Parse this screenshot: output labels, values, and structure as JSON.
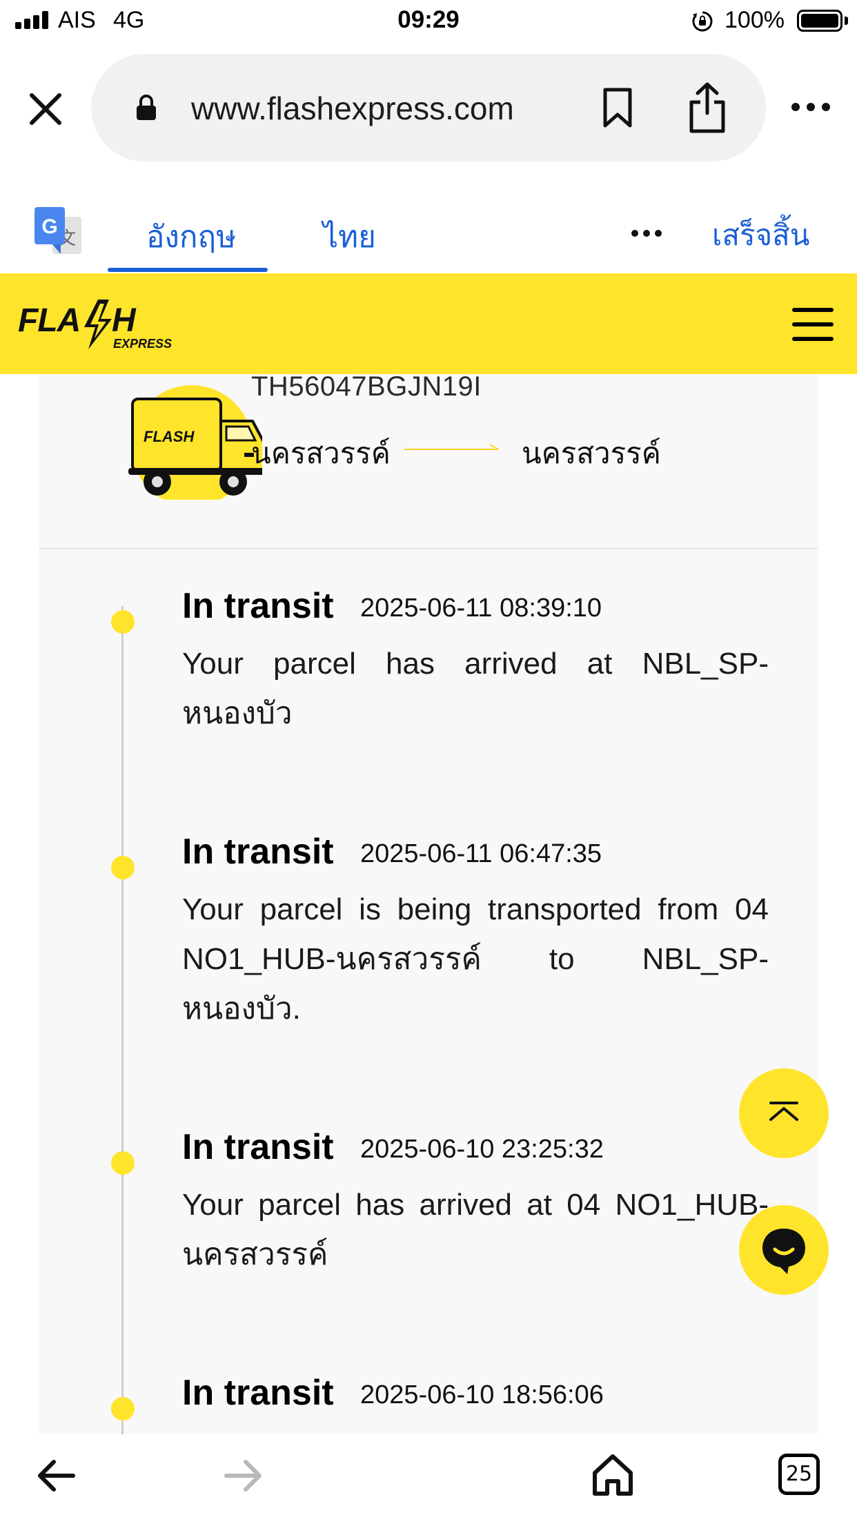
{
  "status_bar": {
    "carrier": "AIS",
    "network": "4G",
    "time": "09:29",
    "battery_percent": "100%",
    "icons": [
      "signal-icon",
      "rotation-lock-icon",
      "battery-icon"
    ]
  },
  "browser": {
    "url": "www.flashexpress.com",
    "tab_count": "25",
    "icons": [
      "close-icon",
      "padlock-icon",
      "bookmark-icon",
      "share-icon",
      "more-icon",
      "back-icon",
      "forward-icon",
      "home-icon",
      "tabs-icon"
    ]
  },
  "translate_bar": {
    "tab_english": "อังกฤษ",
    "tab_thai": "ไทย",
    "done": "เสร็จสิ้น",
    "active_tab": "อังกฤษ"
  },
  "site": {
    "brand_color": "#ffe42c",
    "logo_alt": "FLASH EXPRESS"
  },
  "shipment": {
    "tracking_number": "TH56047BGJN19I",
    "origin": "นครสวรรค์",
    "destination": "นครสวรรค์"
  },
  "events": [
    {
      "status": "In transit",
      "time": "2025-06-11 08:39:10",
      "message": "Your parcel has arrived at NBL_SP-หนองบัว"
    },
    {
      "status": "In transit",
      "time": "2025-06-11 06:47:35",
      "message": "Your parcel is being transported from 04 NO1_HUB-นครสวรรค์ to NBL_SP-หนองบัว."
    },
    {
      "status": "In transit",
      "time": "2025-06-10 23:25:32",
      "message": "Your parcel has arrived at 04 NO1_HUB-นครสวรรค์"
    },
    {
      "status": "In transit",
      "time": "2025-06-10 18:56:06",
      "message": ""
    }
  ]
}
